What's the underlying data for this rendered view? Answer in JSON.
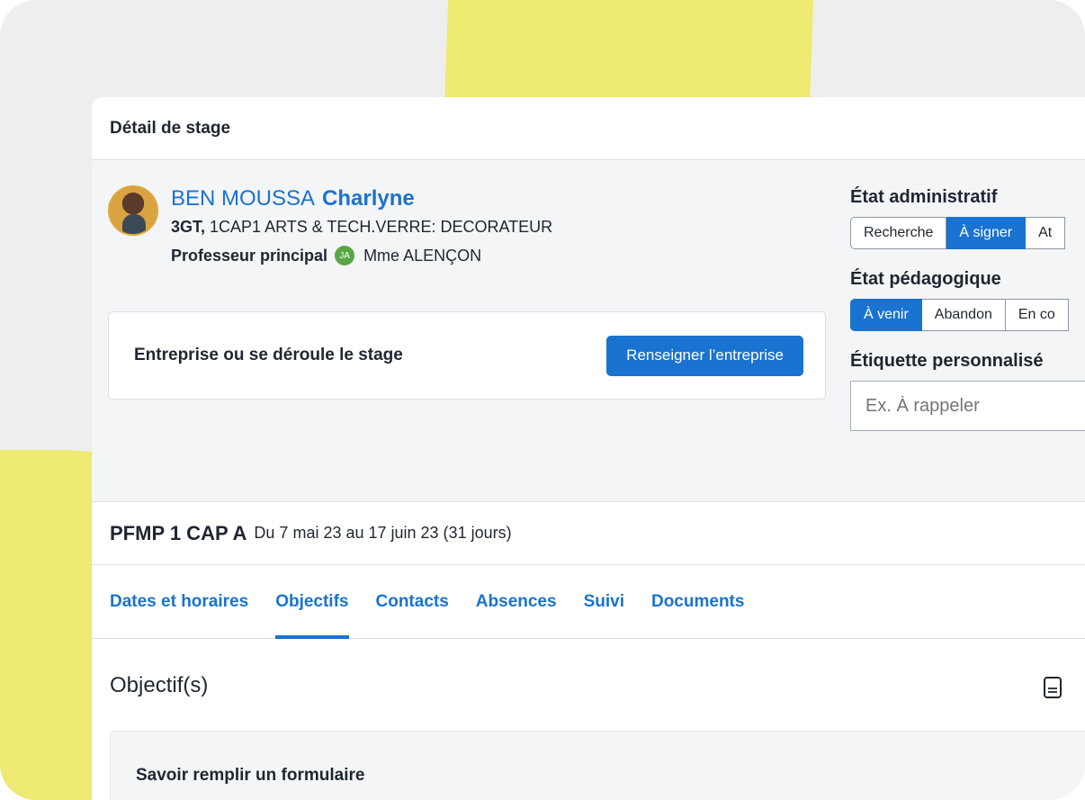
{
  "card": {
    "title": "Détail de stage"
  },
  "student": {
    "last_name": "BEN MOUSSA",
    "first_name": "Charlyne",
    "class_code": "3GT,",
    "class_detail": "1CAP1 ARTS & TECH.VERRE: DECORATEUR",
    "prof_label": "Professeur principal",
    "prof_initials": "JA",
    "prof_name": "Mme ALENÇON"
  },
  "company": {
    "label": "Entreprise ou se déroule le stage",
    "button": "Renseigner l’entreprise"
  },
  "admin_state": {
    "title": "État administratif",
    "options": [
      "Recherche",
      "À signer",
      "At"
    ],
    "selected": "À signer"
  },
  "peda_state": {
    "title": "État pédagogique",
    "options": [
      "À venir",
      "Abandon",
      "En co"
    ],
    "selected": "À venir"
  },
  "custom_label": {
    "title": "Étiquette personnalisé",
    "placeholder": "Ex. À rappeler"
  },
  "period": {
    "code": "PFMP 1 CAP A",
    "dates": "Du 7 mai 23 au 17 juin 23 (31 jours)"
  },
  "tabs": [
    {
      "label": "Dates et horaires",
      "active": false
    },
    {
      "label": "Objectifs",
      "active": true
    },
    {
      "label": "Contacts",
      "active": false
    },
    {
      "label": "Absences",
      "active": false
    },
    {
      "label": "Suivi",
      "active": false
    },
    {
      "label": "Documents",
      "active": false
    }
  ],
  "objectives": {
    "title": "Objectif(s)",
    "items": [
      "Savoir remplir un formulaire"
    ],
    "icon": "document-icon"
  },
  "colors": {
    "accent": "#1a73d0",
    "background_yellow": "#eeea72",
    "badge_green": "#58a846"
  }
}
